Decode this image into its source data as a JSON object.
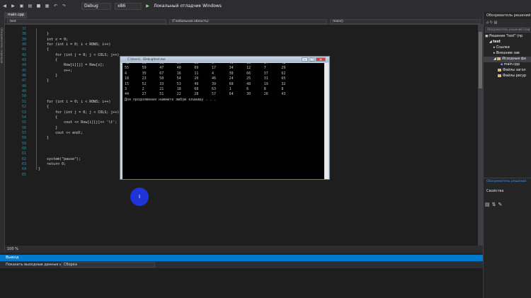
{
  "toolbar": {
    "config": "Debug",
    "platform": "x86",
    "debugger": "Локальный отладчик Windows",
    "icons": [
      "back-icon",
      "forward-icon",
      "new-icon",
      "open-icon",
      "save-icon",
      "save-all-icon",
      "undo-icon",
      "redo-icon",
      "play-icon"
    ]
  },
  "editor": {
    "tab": "main.cpp",
    "nav": {
      "project": "test",
      "scope": "(Глобальная область)",
      "member": "main()"
    },
    "lines": [
      {
        "n": "37",
        "t": ""
      },
      {
        "n": "38",
        "t": "    }"
      },
      {
        "n": "39",
        "t": "    int x = 0;"
      },
      {
        "n": "40",
        "t": "    for (int i = 0; i < ROWS; i++)"
      },
      {
        "n": "41",
        "t": "    {"
      },
      {
        "n": "42",
        "t": "        for (int j = 0; j < COLS; j++)"
      },
      {
        "n": "43",
        "t": "        {"
      },
      {
        "n": "44",
        "t": "            Row[i][j] = Rew[x];"
      },
      {
        "n": "45",
        "t": "            x++;"
      },
      {
        "n": "46",
        "t": "        }"
      },
      {
        "n": "47",
        "t": "    }"
      },
      {
        "n": "48",
        "t": ""
      },
      {
        "n": "49",
        "t": ""
      },
      {
        "n": "50",
        "t": ""
      },
      {
        "n": "51",
        "t": "    for (int i = 0; i < ROWS; i++)"
      },
      {
        "n": "52",
        "t": "    {"
      },
      {
        "n": "53",
        "t": "        for (int j = 0; j < COLS; j++)"
      },
      {
        "n": "54",
        "t": "        {"
      },
      {
        "n": "55",
        "t": "            cout << Row[i][j]<< '\\t';"
      },
      {
        "n": "56",
        "t": "        }"
      },
      {
        "n": "57",
        "t": "        cout << endl;"
      },
      {
        "n": "58",
        "t": "    }"
      },
      {
        "n": "59",
        "t": ""
      },
      {
        "n": "60",
        "t": ""
      },
      {
        "n": "61",
        "t": ""
      },
      {
        "n": "62",
        "t": "    system(\"pause\");"
      },
      {
        "n": "63",
        "t": "    return 0;"
      },
      {
        "n": "64",
        "t": "}"
      },
      {
        "n": "65",
        "t": ""
      }
    ],
    "zoom": "100 %"
  },
  "console": {
    "title": "C:\\Users\\...\\Debug\\test.exe",
    "rows": [
      [
        "41",
        "61",
        "58",
        "56",
        "36",
        "9",
        "45",
        "13",
        "14",
        "42"
      ],
      [
        "55",
        "59",
        "47",
        "40",
        "69",
        "17",
        "34",
        "12",
        "7",
        "29"
      ],
      [
        "4",
        "35",
        "67",
        "16",
        "11",
        "4",
        "38",
        "66",
        "37",
        "62"
      ],
      [
        "18",
        "23",
        "58",
        "54",
        "20",
        "46",
        "24",
        "25",
        "31",
        "65"
      ],
      [
        "15",
        "52",
        "33",
        "53",
        "49",
        "39",
        "68",
        "48",
        "19",
        "32"
      ],
      [
        "3",
        "2",
        "21",
        "18",
        "68",
        "63",
        "1",
        "6",
        "8",
        "8"
      ],
      [
        "44",
        "27",
        "51",
        "22",
        "28",
        "57",
        "64",
        "30",
        "26",
        "43"
      ]
    ],
    "prompt": "Для продолжения нажмите любую клавишу . . ."
  },
  "output": {
    "title": "Вывод",
    "show_label": "Показать выходные данные из:",
    "source": "Сборка"
  },
  "solution_explorer": {
    "title": "Обозреватель решений",
    "search": "Обозреватель решений (поиск)",
    "items": [
      "Решение \"test\" (пр",
      "test",
      "Ссылки",
      "Внешние зав",
      "Исходные фа",
      "main.cpp",
      "Файлы загол",
      "Файлы ресур"
    ],
    "footer": "Обозреватель решений",
    "properties": "Свойства"
  },
  "cursor": {
    "symbol": "I"
  }
}
